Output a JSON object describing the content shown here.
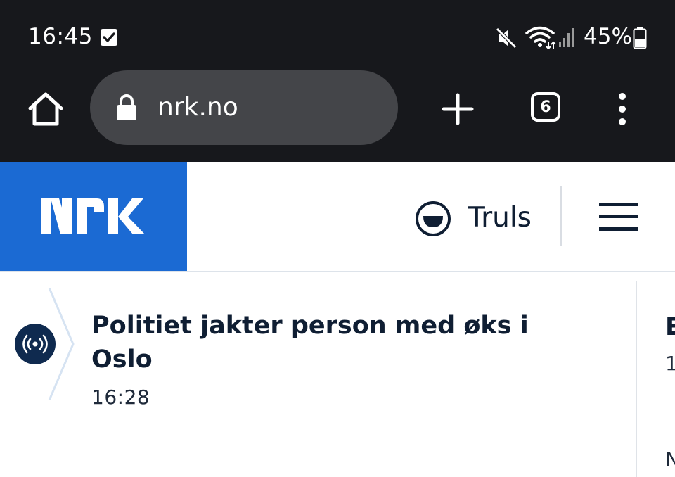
{
  "status_bar": {
    "time": "16:45",
    "battery_percent": "45%",
    "icons": [
      "checkbox-notification-icon",
      "mute-icon",
      "wifi-icon",
      "signal-icon",
      "battery-icon"
    ]
  },
  "browser": {
    "url": "nrk.no",
    "tab_count": "6",
    "icons": [
      "home-icon",
      "lock-icon",
      "new-tab-icon",
      "menu-icon"
    ]
  },
  "site_header": {
    "logo_text": "NRK",
    "user_name": "Truls",
    "brand_color": "#1b6ad3",
    "icons": [
      "user-face-icon",
      "hamburger-menu-icon"
    ]
  },
  "articles": [
    {
      "title": "Politiet jakter person med øks i Oslo",
      "time": "16:28",
      "badge": "live-broadcast-icon"
    },
    {
      "title_partial": "E",
      "time_partial": "1",
      "extra_partial": "N"
    }
  ]
}
